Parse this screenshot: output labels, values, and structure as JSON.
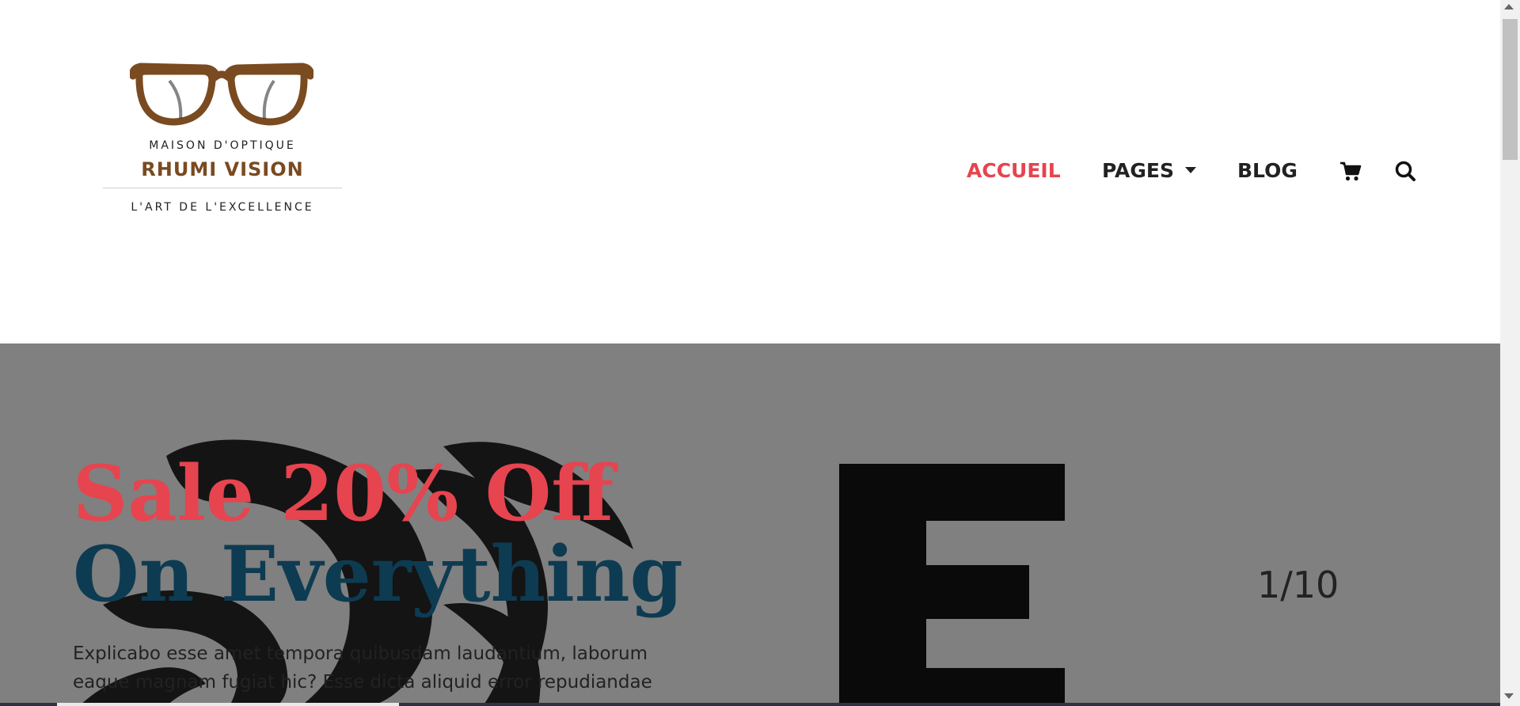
{
  "logo": {
    "tagline_top": "MAISON D'OPTIQUE",
    "brand_name": "RHUMI VISION",
    "tagline_bottom": "L'ART DE L'EXCELLENCE",
    "icon": "glasses-icon"
  },
  "nav": {
    "items": [
      {
        "label": "ACCUEIL",
        "active": true
      },
      {
        "label": "PAGES",
        "has_dropdown": true
      },
      {
        "label": "BLOG"
      }
    ],
    "cart_icon": "cart-icon",
    "search_icon": "search-icon"
  },
  "hero": {
    "headline_line1": "Sale 20% Off",
    "headline_line2": "On Everything",
    "body": "Explicabo esse amet tempora quibusdam laudantium, laborum eaque magnam fugiat hic? Esse dicta aliquid error repudiandae",
    "counter": "1/10",
    "background_color": "#808080"
  },
  "colors": {
    "accent": "#e6444f",
    "headline_dark": "#0d3b52",
    "brand_brown": "#7a4a20"
  }
}
